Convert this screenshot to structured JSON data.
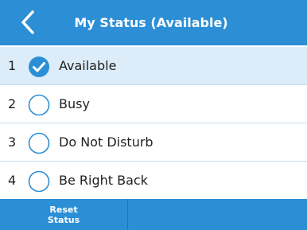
{
  "header": {
    "title": "My Status (Available)",
    "back_icon": "chevron-left-icon"
  },
  "status_options": [
    {
      "number": "1",
      "label": "Available",
      "selected": true
    },
    {
      "number": "2",
      "label": "Busy",
      "selected": false
    },
    {
      "number": "3",
      "label": "Do Not Disturb",
      "selected": false
    },
    {
      "number": "4",
      "label": "Be Right Back",
      "selected": false
    }
  ],
  "footer": {
    "reset_label_line1": "Reset",
    "reset_label_line2": "Status"
  },
  "colors": {
    "accent": "#2c8fd6",
    "selected_row": "#dcedf9",
    "check_fill": "#2c8fd6"
  }
}
